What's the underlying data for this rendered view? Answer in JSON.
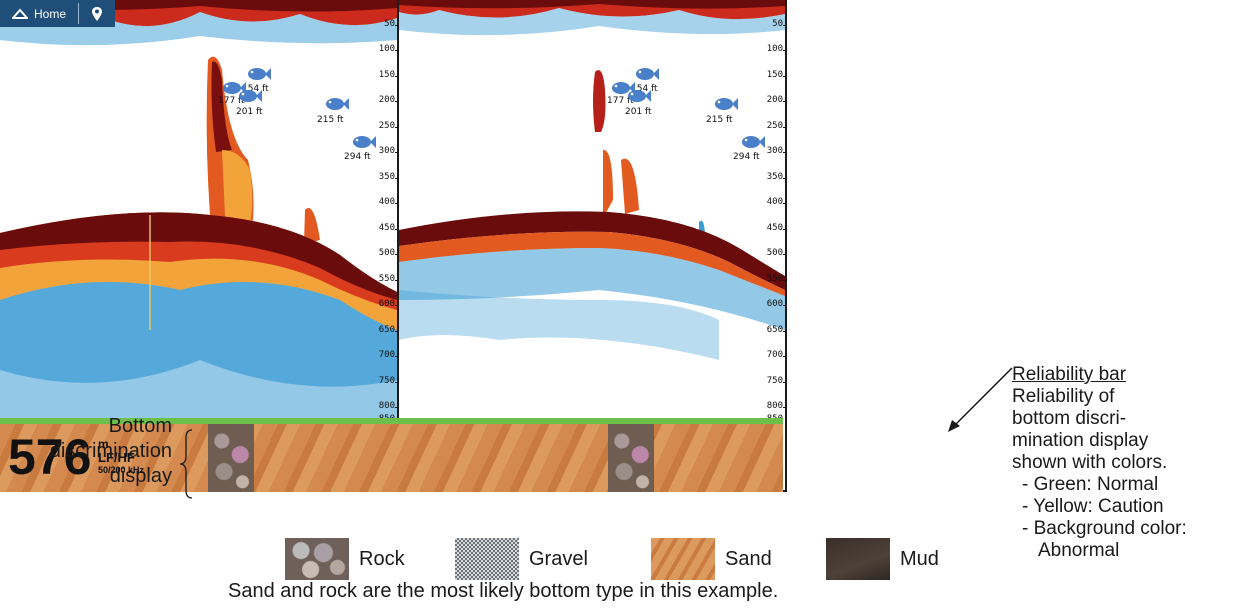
{
  "homebar": {
    "home_label": "Home"
  },
  "depth_scale": [
    "50",
    "100",
    "150",
    "200",
    "250",
    "300",
    "350",
    "400",
    "450",
    "500",
    "550",
    "600",
    "650",
    "700",
    "750",
    "800",
    "850"
  ],
  "fish_left": [
    {
      "label": "154 ft"
    },
    {
      "label": "177 ft"
    },
    {
      "label": "201 ft"
    },
    {
      "label": "215 ft"
    },
    {
      "label": "294 ft"
    }
  ],
  "fish_right": [
    {
      "label": "154 ft"
    },
    {
      "label": "177 ft"
    },
    {
      "label": "201 ft"
    },
    {
      "label": "215 ft"
    },
    {
      "label": "294 ft"
    }
  ],
  "readout": {
    "depth": "576",
    "unit": "m",
    "mode": "LF/HF",
    "freq": "50/200 kHz"
  },
  "bottom_label": [
    "Bottom",
    "discrimination",
    "display"
  ],
  "annotation": {
    "title": "Reliability bar",
    "lines": [
      "Reliability of",
      "bottom discri-",
      "mination display",
      "shown with colors."
    ],
    "items": [
      "- Green: Normal",
      "- Yellow: Caution",
      "- Background color:",
      "Abnormal"
    ]
  },
  "legend": [
    "Rock",
    "Gravel",
    "Sand",
    "Mud"
  ],
  "caption": "Sand and rock are the most likely bottom type in this example.",
  "colors": {
    "reliability_normal": "#6cc04a",
    "homebar": "#1f4e79",
    "sand": "#d48a4e"
  }
}
